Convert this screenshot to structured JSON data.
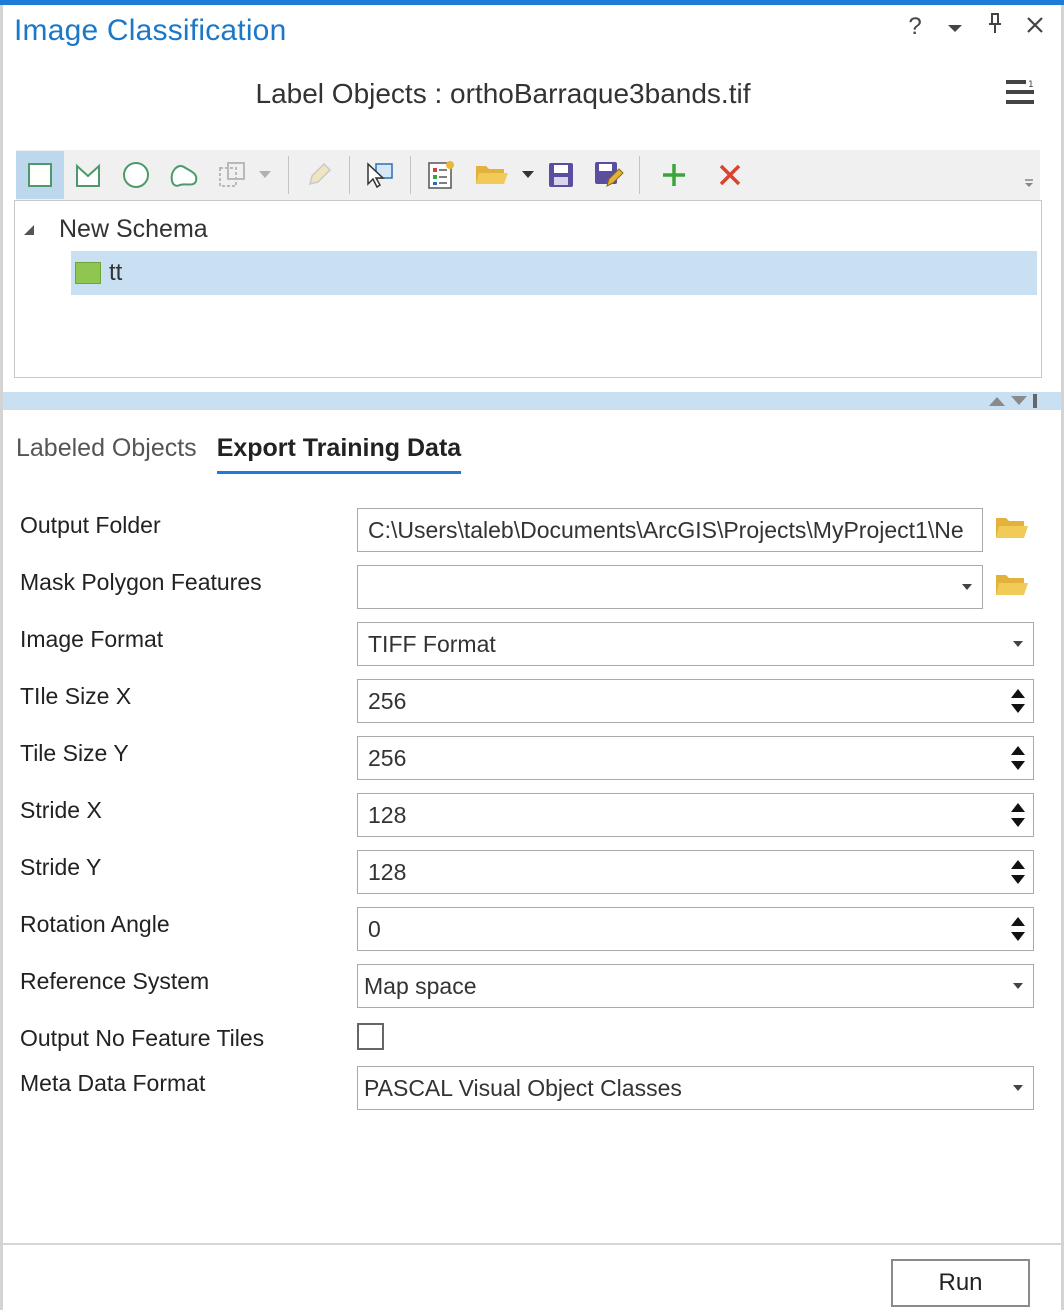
{
  "pane": {
    "title": "Image Classification",
    "subtitle": "Label Objects : orthoBarraque3bands.tif",
    "help_glyph": "?",
    "dropdown_glyph": "▾",
    "pin_glyph": "⊥",
    "close_glyph": "✕"
  },
  "toolbar": {
    "icons": [
      "rectangle-icon",
      "polygon-icon",
      "circle-icon",
      "freehand-icon",
      "auto-detect-icon",
      "edit-label-icon",
      "select-icon",
      "new-template-icon",
      "open-folder-icon",
      "save-icon",
      "save-as-icon",
      "add-class-icon",
      "delete-class-icon"
    ]
  },
  "schema_tree": {
    "root_label": "New Schema",
    "items": [
      {
        "label": "tt",
        "color": "#8fc651"
      }
    ]
  },
  "tabs": [
    {
      "label": "Labeled Objects",
      "active": false
    },
    {
      "label": "Export Training Data",
      "active": true
    }
  ],
  "form": {
    "output_folder": {
      "label": "Output Folder",
      "value": "C:\\Users\\taleb\\Documents\\ArcGIS\\Projects\\MyProject1\\Ne"
    },
    "mask_polygon": {
      "label": "Mask Polygon Features",
      "value": ""
    },
    "image_format": {
      "label": "Image Format",
      "value": "TIFF Format"
    },
    "tile_size_x": {
      "label": "TIle Size X",
      "value": "256"
    },
    "tile_size_y": {
      "label": "Tile Size Y",
      "value": "256"
    },
    "stride_x": {
      "label": "Stride X",
      "value": "128"
    },
    "stride_y": {
      "label": "Stride Y",
      "value": "128"
    },
    "rotation_angle": {
      "label": "Rotation Angle",
      "value": "0"
    },
    "reference_system": {
      "label": "Reference System",
      "value": "Map space"
    },
    "output_no_feature_tiles": {
      "label": "Output No Feature Tiles",
      "checked": false
    },
    "meta_data_format": {
      "label": "Meta Data Format",
      "value": "PASCAL Visual Object Classes"
    }
  },
  "run_button": {
    "label": "Run"
  },
  "colors": {
    "accent": "#1e7bd6",
    "title": "#1b78c8",
    "selection": "#c9dff2",
    "folder": "#e8b83a",
    "add": "#3aa53a",
    "delete": "#d9442e"
  }
}
